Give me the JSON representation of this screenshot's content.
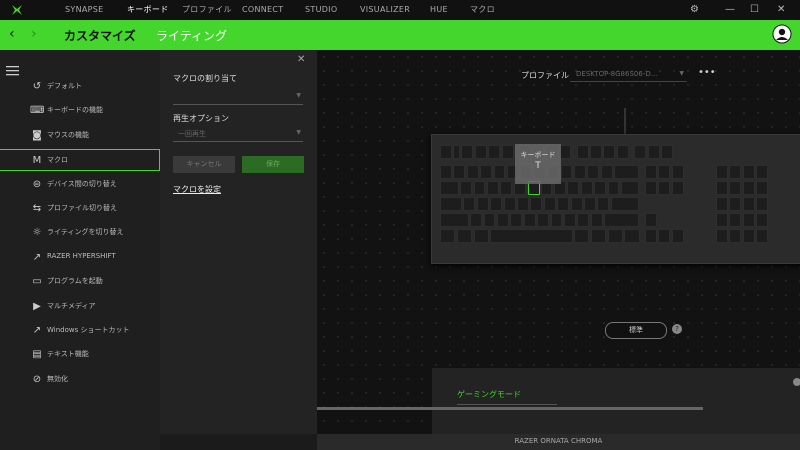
{
  "nav": {
    "tabs": [
      "SYNAPSE",
      "キーボード",
      "プロファイル",
      "CONNECT",
      "STUDIO",
      "VISUALIZER",
      "HUE",
      "マクロ"
    ],
    "active_tab": "キーボード"
  },
  "header": {
    "tab_customize": "カスタマイズ",
    "tab_lighting": "ライティング"
  },
  "sidebar": {
    "items": [
      {
        "label": "デフォルト",
        "icon": "undo-icon"
      },
      {
        "label": "キーボードの機能",
        "icon": "keyboard-icon"
      },
      {
        "label": "マウスの機能",
        "icon": "mouse-icon"
      },
      {
        "label": "マクロ",
        "icon": "macro-icon"
      },
      {
        "label": "デバイス間の切り替え",
        "icon": "device-switch-icon"
      },
      {
        "label": "プロファイル切り替え",
        "icon": "profile-switch-icon"
      },
      {
        "label": "ライティングを切り替え",
        "icon": "sun-icon"
      },
      {
        "label": "RAZER HYPERSHIFT",
        "icon": "arrow-icon"
      },
      {
        "label": "プログラムを起動",
        "icon": "launch-icon"
      },
      {
        "label": "マルチメディア",
        "icon": "play-icon"
      },
      {
        "label": "Windows ショートカット",
        "icon": "shortcut-icon"
      },
      {
        "label": "テキスト機能",
        "icon": "text-icon"
      },
      {
        "label": "無効化",
        "icon": "disable-icon"
      }
    ],
    "active_index": 3
  },
  "macro_panel": {
    "assign_label": "マクロの割り当て",
    "playback_label": "再生オプション",
    "playback_value": "一回再生",
    "cancel_label": "キャンセル",
    "save_label": "保存",
    "macro_settings_link": "マクロを設定"
  },
  "main": {
    "profile_label": "プロファイル",
    "profile_value": "DESKTOP-8G86S06-D...",
    "tooltip_line1": "キーボード",
    "tooltip_line2": "T",
    "standard_button": "標準",
    "gaming_mode_label": "ゲーミングモード",
    "device_name": "RAZER ORNATA CHROMA"
  },
  "colors": {
    "accent": "#44d62c"
  }
}
